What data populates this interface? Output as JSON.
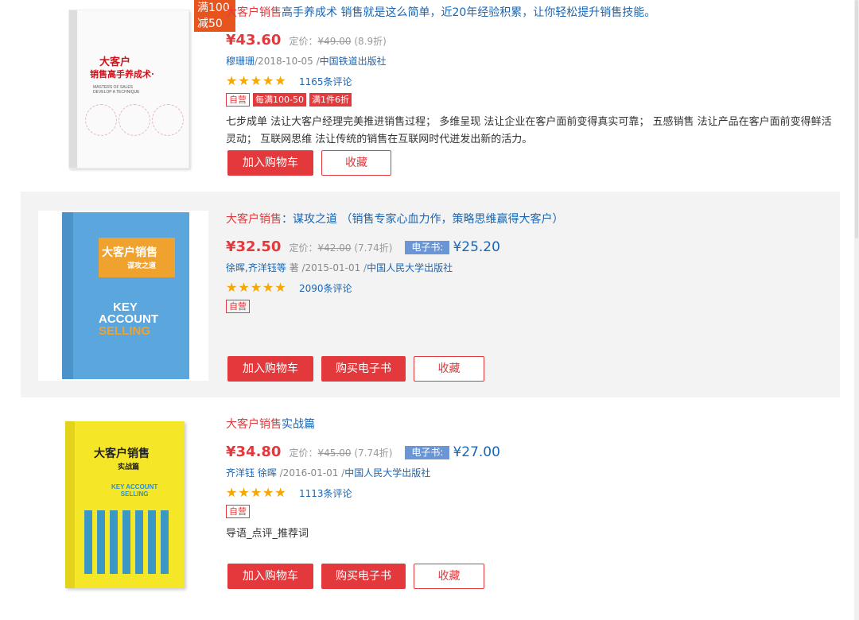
{
  "books": [
    {
      "title_kw": "大客户销售",
      "title_rest": "高手养成术  销售就是这么简单，近20年经验积累，让你轻松提升销售技能。",
      "price": "¥43.60",
      "list_label": "定价：",
      "list_price": "¥49.00",
      "discount": "(8.9折)",
      "author": "穆珊珊",
      "date": "/2018-10-05 /",
      "publisher": "中国铁道出版社",
      "rating": 5,
      "reviews": "1165条评论",
      "tags": [
        "自营",
        "每满100-50",
        "满1件6折"
      ],
      "desc": "七步成单 法让大客户经理完美推进销售过程； 多维呈现 法让企业在客户面前变得真实可靠； 五感销售 法让产品在客户面前变得鲜活灵动； 互联网思维 法让传统的销售在互联网时代迸发出新的活力。",
      "promo_line1": "满100",
      "promo_line2": "减50",
      "cover": {
        "title_line1": "大客户",
        "title_line2": "销售高手养成术·",
        "sub": "MASTERS OF SALES\nDEVELOP A TECHNIQUE"
      },
      "buttons": [
        "加入购物车",
        "收藏"
      ]
    },
    {
      "title_kw": "大客户销售",
      "title_rest": "：谋攻之道 （销售专家心血力作，策略思维赢得大客户）",
      "price": "¥32.50",
      "list_label": "定价：",
      "list_price": "¥42.00",
      "discount": "(7.74折)",
      "ebook_label": "电子书:",
      "ebook_price": "¥25.20",
      "author": "徐晖,齐洋钰等",
      "author_suffix": " 著 /2015-01-01 /",
      "publisher": "中国人民大学出版社",
      "rating": 4.5,
      "reviews": "2090条评论",
      "tags": [
        "自营"
      ],
      "cover": {
        "title_line1": "大客户销售",
        "title_line2": "谋攻之道",
        "en1": "KEY",
        "en2": "ACCOUNT",
        "en3": "SELLING"
      },
      "buttons": [
        "加入购物车",
        "购买电子书",
        "收藏"
      ]
    },
    {
      "title_kw": "大客户销售",
      "title_rest": "实战篇",
      "price": "¥34.80",
      "list_label": "定价：",
      "list_price": "¥45.00",
      "discount": "(7.74折)",
      "ebook_label": "电子书:",
      "ebook_price": "¥27.00",
      "author": "齐洋钰 徐晖",
      "author_suffix": " /2016-01-01 /",
      "publisher": "中国人民大学出版社",
      "rating": 4.5,
      "reviews": "1113条评论",
      "tags": [
        "自营"
      ],
      "desc": "导语_点评_推荐词",
      "cover": {
        "title_line1": "大客户销售",
        "title_line2": "实战篇",
        "en1": "KEY ACCOUNT",
        "en2": "SELLING"
      },
      "buttons": [
        "加入购物车",
        "购买电子书",
        "收藏"
      ]
    }
  ],
  "colors": {
    "accent_red": "#e4393c",
    "link_blue": "#1a66b3",
    "star": "#f6a800",
    "promo_orange": "#e8541e",
    "ebook_tag": "#6b96d6"
  }
}
